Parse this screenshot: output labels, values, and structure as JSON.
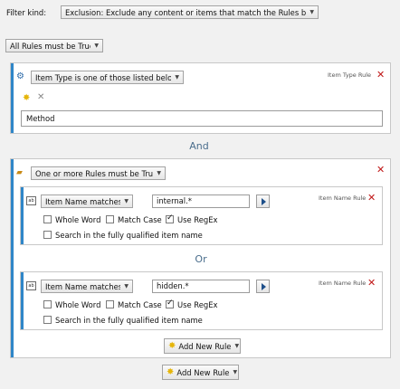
{
  "filter": {
    "label": "Filter kind:",
    "value": "Exclusion: Exclude any content or items that match the Rules below"
  },
  "top_combinator": "All Rules must be True",
  "rule1": {
    "type_label": "Item Type Rule",
    "selector": "Item Type is one of those listed below",
    "item": "Method"
  },
  "and_label": "And",
  "group": {
    "selector": "One or more Rules must be True",
    "rule_a": {
      "type_label": "Item Name Rule",
      "selector": "Item Name matches:",
      "value": "internal.*",
      "whole_word": "Whole Word",
      "match_case": "Match Case",
      "use_regex": "Use RegEx",
      "fully_qualified": "Search in the fully qualified item name"
    },
    "or_label": "Or",
    "rule_b": {
      "type_label": "Item Name Rule",
      "selector": "Item Name matches:",
      "value": "hidden.*",
      "whole_word": "Whole Word",
      "match_case": "Match Case",
      "use_regex": "Use RegEx",
      "fully_qualified": "Search in the fully qualified item name"
    },
    "add_rule": "Add New Rule"
  },
  "add_rule": "Add New Rule",
  "icons": {
    "delete": "delete-x-icon",
    "add": "sun-add-icon",
    "play": "play-arrow-icon"
  },
  "colors": {
    "accent": "#2f86c8",
    "delete": "#c01818",
    "connector": "#4a6d8c"
  }
}
